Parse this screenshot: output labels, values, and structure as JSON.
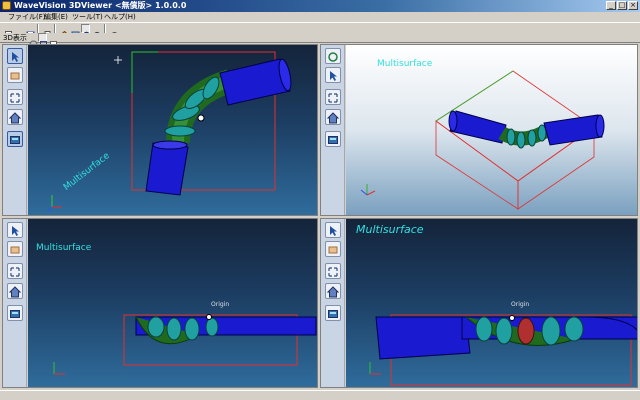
{
  "window": {
    "title": "WaveVision 3DViewer <無償版> 1.0.0.0"
  },
  "window_controls": {
    "minimize": "_",
    "maximize": "□",
    "close": "×"
  },
  "menu": [
    {
      "label": "ファイル(F)"
    },
    {
      "label": "編集(E)"
    },
    {
      "label": "ツール(T)"
    },
    {
      "label": "ヘルプ(H)"
    }
  ],
  "toolbar2": {
    "label": "3D表示"
  },
  "viewports": {
    "top_left": {
      "label": "Multisurface"
    },
    "top_right": {
      "label": "Multisurface"
    },
    "bottom_left": {
      "label": "Multisurface",
      "origin": "Origin"
    },
    "bottom_right": {
      "label": "Multisurface",
      "origin": "Origin"
    }
  },
  "colors": {
    "pipe_blue": "#1a1ad0",
    "pipe_green": "#2f8f2f",
    "bounding_box": "#e03030",
    "label_cyan": "#33e0e0"
  },
  "icons": [
    "select-icon",
    "box-icon",
    "fit-icon",
    "home-icon",
    "view-icon"
  ]
}
